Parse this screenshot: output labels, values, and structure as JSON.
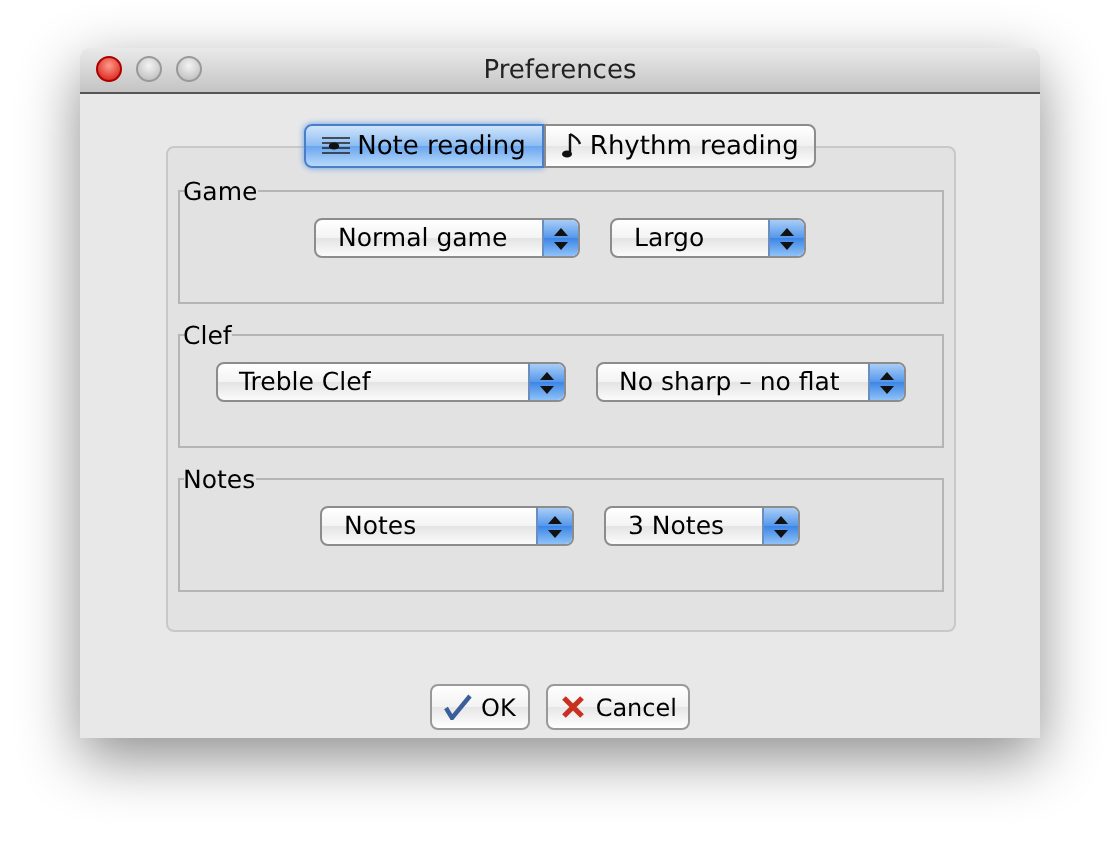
{
  "window": {
    "title": "Preferences"
  },
  "tabs": [
    {
      "label": "Note reading",
      "selected": true
    },
    {
      "label": "Rhythm reading",
      "selected": false
    }
  ],
  "groups": [
    {
      "title": "Game",
      "selects": [
        {
          "value": "Normal game"
        },
        {
          "value": "Largo"
        }
      ]
    },
    {
      "title": "Clef",
      "selects": [
        {
          "value": "Treble Clef"
        },
        {
          "value": "No sharp – no flat"
        }
      ]
    },
    {
      "title": "Notes",
      "selects": [
        {
          "value": "Notes"
        },
        {
          "value": "3 Notes"
        }
      ]
    }
  ],
  "buttons": [
    {
      "label": "OK",
      "kind": "ok"
    },
    {
      "label": "Cancel",
      "kind": "cancel"
    }
  ]
}
